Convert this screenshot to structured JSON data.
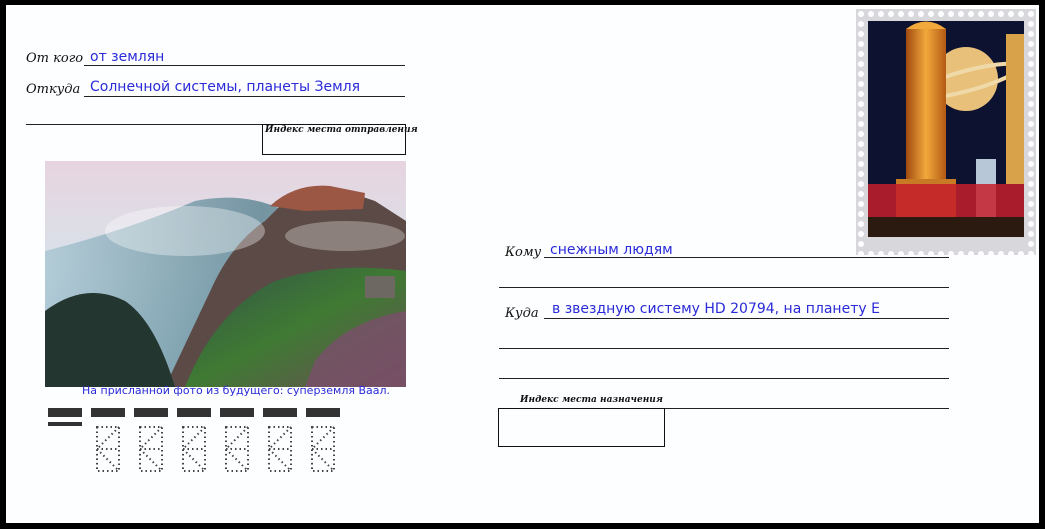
{
  "sender": {
    "from_label": "От кого",
    "from_value": "от землян",
    "where_label": "Откуда",
    "where_value": "Солнечной системы, планеты Земля",
    "index_label": "Индекс места отправления"
  },
  "photo": {
    "caption": "На присланной фото  из будущего: суперземля Ваал."
  },
  "recipient": {
    "to_label": "Кому",
    "to_value": "снежным людям",
    "where_label": "Куда",
    "where_value": "в звездную систему HD 20794, на  планету Е",
    "index_label": "Индекс места назначения"
  },
  "colors": {
    "handwriting_blue": "#2a2ad8",
    "paper": "#fdfeff"
  },
  "icons": {
    "stamp": "postage-stamp-retro-space-city",
    "postcode_grid": "postcode-digit-stencils"
  }
}
